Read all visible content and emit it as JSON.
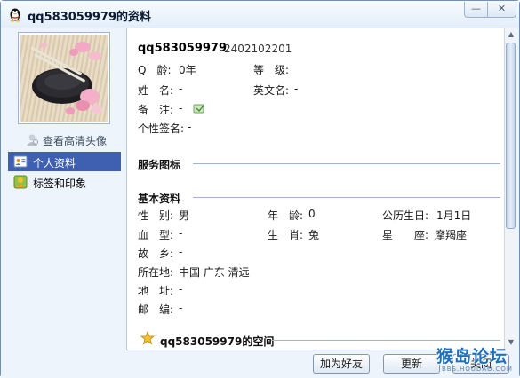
{
  "window": {
    "title": "qq583059979的资料",
    "minimize_glyph": "—",
    "close_glyph": "✕"
  },
  "sidebar": {
    "view_hd_avatar": "查看高清头像",
    "items": [
      {
        "label": "个人资料",
        "selected": true,
        "icon": "profile-card-icon"
      },
      {
        "label": "标签和印象",
        "selected": false,
        "icon": "tag-impression-icon"
      }
    ]
  },
  "profile": {
    "nickname": "qq583059979",
    "qq_number": "2402102201",
    "q_age_label": "Q　龄:",
    "q_age_value": "0年",
    "level_label": "等　级:",
    "level_value": "",
    "name_label": "姓　名:",
    "name_value": "-",
    "english_name_label": "英文名:",
    "english_name_value": "-",
    "remark_label": "备　注:",
    "remark_value": "-",
    "signature_label": "个性签名:",
    "signature_value": "-"
  },
  "sections": {
    "service_icons": "服务图标",
    "basic_info": "基本资料",
    "space": "qq583059979的空间"
  },
  "basic": {
    "gender_label": "性　别:",
    "gender_value": "男",
    "age_label": "年　龄:",
    "age_value": "0",
    "birthday_label": "公历生日:",
    "birthday_value": "1月1日",
    "blood_label": "血　型:",
    "blood_value": "-",
    "zodiac_label": "生　肖:",
    "zodiac_value": "兔",
    "constellation_label": "星　　座:",
    "constellation_value": "摩羯座",
    "hometown_label": "故　乡:",
    "hometown_value": "-",
    "location_label": "所在地:",
    "location_value": "中国 广东 清远",
    "address_label": "地　址:",
    "address_value": "-",
    "postcode_label": "邮　编:",
    "postcode_value": "-"
  },
  "footer": {
    "add_friend": "加为好友",
    "refresh": "更新",
    "close": "关闭"
  },
  "watermark": {
    "text": "猴岛论坛",
    "url": "BBS.HOUDAO.COM"
  },
  "colors": {
    "selected_nav": "#3f5fb0",
    "section_line": "#9fb7d4",
    "window_bg": "#eef4fb"
  }
}
